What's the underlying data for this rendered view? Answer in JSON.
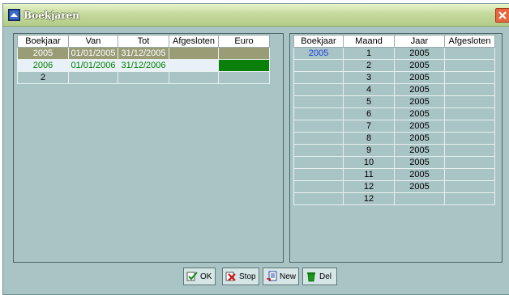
{
  "window": {
    "title": "Boekjaren"
  },
  "left_table": {
    "headers": [
      "Boekjaar",
      "Van",
      "Tot",
      "Afgesloten",
      "Euro"
    ],
    "rows": [
      {
        "boekjaar": "2005",
        "van": "01/01/2005",
        "tot": "31/12/2005",
        "afgesloten": "",
        "euro": ""
      },
      {
        "boekjaar": "2006",
        "van": "01/01/2006",
        "tot": "31/12/2006",
        "afgesloten": "",
        "euro": ""
      }
    ],
    "count": "2"
  },
  "right_table": {
    "headers": [
      "Boekjaar",
      "Maand",
      "Jaar",
      "Afgesloten"
    ],
    "boekjaar": "2005",
    "rows": [
      {
        "maand": "1",
        "jaar": "2005"
      },
      {
        "maand": "2",
        "jaar": "2005"
      },
      {
        "maand": "3",
        "jaar": "2005"
      },
      {
        "maand": "4",
        "jaar": "2005"
      },
      {
        "maand": "5",
        "jaar": "2005"
      },
      {
        "maand": "6",
        "jaar": "2005"
      },
      {
        "maand": "7",
        "jaar": "2005"
      },
      {
        "maand": "8",
        "jaar": "2005"
      },
      {
        "maand": "9",
        "jaar": "2005"
      },
      {
        "maand": "10",
        "jaar": "2005"
      },
      {
        "maand": "11",
        "jaar": "2005"
      },
      {
        "maand": "12",
        "jaar": "2005"
      }
    ],
    "count": "12"
  },
  "buttons": {
    "ok": "OK",
    "stop": "Stop",
    "new": "New",
    "del": "Del"
  },
  "colors": {
    "panel": "#a9c4c4",
    "selected_row": "#9a9c76",
    "euro_active": "#0a7f0a",
    "year_text": "#008000"
  }
}
